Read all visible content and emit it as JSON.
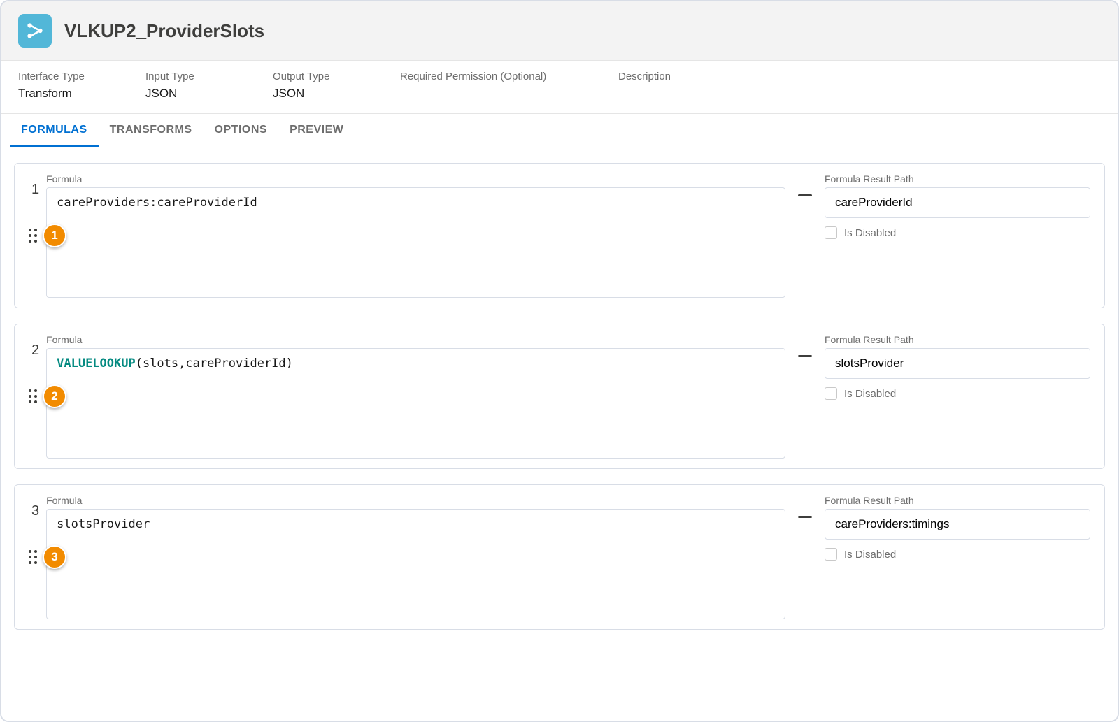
{
  "header": {
    "title": "VLKUP2_ProviderSlots"
  },
  "details": [
    {
      "label": "Interface Type",
      "value": "Transform"
    },
    {
      "label": "Input Type",
      "value": "JSON"
    },
    {
      "label": "Output Type",
      "value": "JSON"
    },
    {
      "label": "Required Permission (Optional)",
      "value": ""
    },
    {
      "label": "Description",
      "value": ""
    }
  ],
  "tabs": [
    {
      "label": "FORMULAS",
      "active": true
    },
    {
      "label": "TRANSFORMS",
      "active": false
    },
    {
      "label": "OPTIONS",
      "active": false
    },
    {
      "label": "PREVIEW",
      "active": false
    }
  ],
  "labels": {
    "formula": "Formula",
    "resultPath": "Formula Result Path",
    "isDisabled": "Is Disabled"
  },
  "formulas": [
    {
      "index": "1",
      "badge": "1",
      "body_plain": "careProviders:careProviderId",
      "body_fn": "",
      "resultPath": "careProviderId",
      "disabled": false
    },
    {
      "index": "2",
      "badge": "2",
      "body_plain": "(slots,careProviderId)",
      "body_fn": "VALUELOOKUP",
      "resultPath": "slotsProvider",
      "disabled": false
    },
    {
      "index": "3",
      "badge": "3",
      "body_plain": "slotsProvider",
      "body_fn": "",
      "resultPath": "careProviders:timings",
      "disabled": false
    }
  ]
}
